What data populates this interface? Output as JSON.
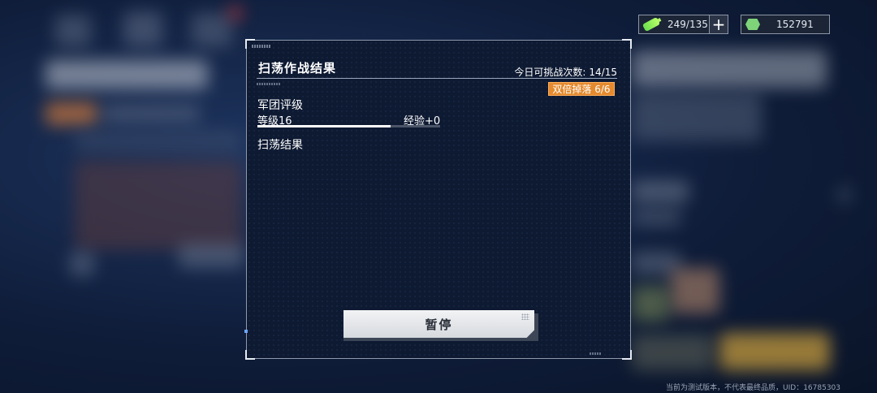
{
  "resources": {
    "stamina": {
      "icon": "battery-icon",
      "value": "249/135",
      "add_label": "+"
    },
    "credits": {
      "icon": "gem-icon",
      "value": "152791"
    }
  },
  "dialog": {
    "title": "扫荡作战结果",
    "attempts_label": "今日可挑战次数:",
    "attempts_value": "14/15",
    "double_drop_badge": "双倍掉落 6/6",
    "rank_section": "军团评级",
    "level_label": "等级16",
    "exp_label": "经验+0",
    "exp_progress": 0.73,
    "results_section": "扫荡结果",
    "pause_button": "暂停"
  },
  "footer_note": "当前为测试版本，不代表最终品质，UID：16785303",
  "colors": {
    "accent_orange": "#e58a2e",
    "panel_bg": "#0e1a32",
    "stamina_green": "#6ae04c"
  }
}
